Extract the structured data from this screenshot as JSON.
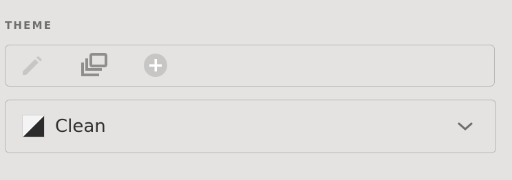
{
  "theme_section": {
    "label": "THEME"
  },
  "toolbar": {
    "edit": {
      "icon": "pencil-icon"
    },
    "duplicate": {
      "icon": "duplicate-icon"
    },
    "add": {
      "icon": "plus-circle-icon"
    }
  },
  "theme_select": {
    "selected": "Clean",
    "swatch_colors": [
      "#f4f4f4",
      "#2b2b2b"
    ],
    "icon": "chevron-down-icon"
  },
  "colors": {
    "background": "#e4e3e2",
    "border": "#b7b6b5",
    "icon_light": "#c7c6c5",
    "icon_dark": "#8f8e8d",
    "text": "#2f2f2f",
    "label": "#6e6e6e"
  }
}
